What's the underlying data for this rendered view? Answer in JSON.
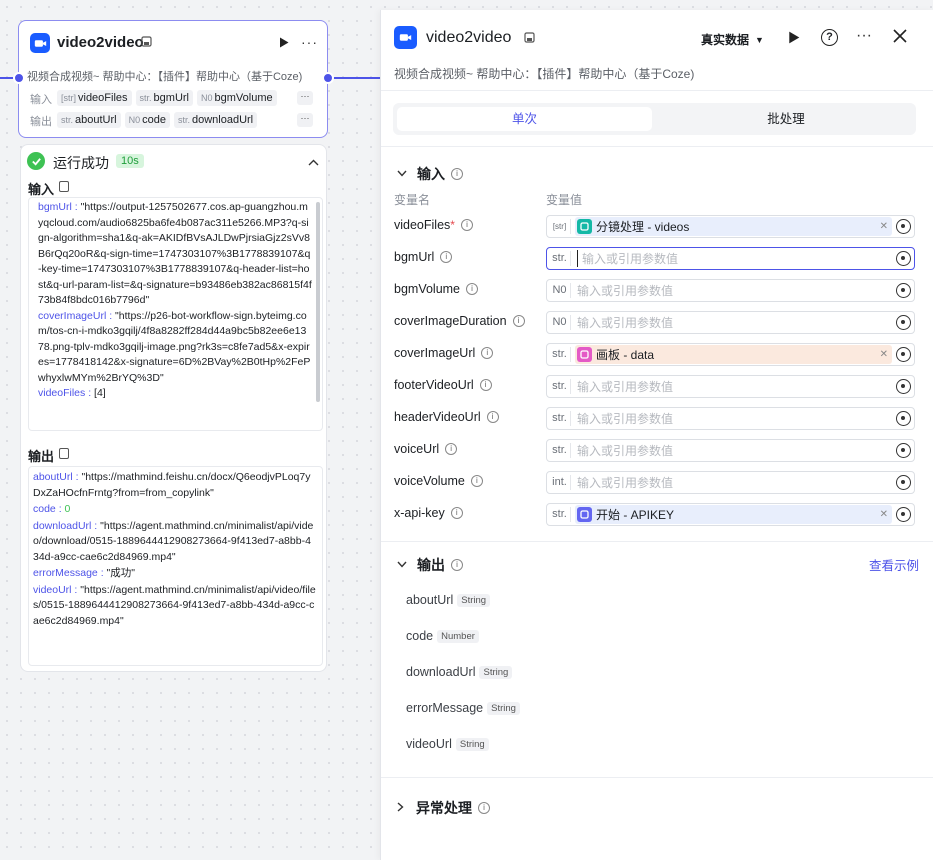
{
  "node": {
    "title": "video2video",
    "description": "视频合成视频~ 帮助中心：【插件】帮助中心（基于Coze)",
    "input_label": "输入",
    "output_label": "输出",
    "inputs": [
      {
        "type": "[str]",
        "name": "videoFiles"
      },
      {
        "type": "str.",
        "name": "bgmUrl"
      },
      {
        "type": "N0",
        "name": "bgmVolume"
      }
    ],
    "outputs": [
      {
        "type": "str.",
        "name": "aboutUrl"
      },
      {
        "type": "N0",
        "name": "code"
      },
      {
        "type": "str.",
        "name": "downloadUrl"
      }
    ],
    "more": "···"
  },
  "result": {
    "status": "运行成功",
    "time": "10s",
    "input_title": "输入",
    "output_title": "输出",
    "input_entries": [
      {
        "key": "bgmUrl",
        "value": "\"https://output-1257502677.cos.ap-guangzhou.myqcloud.com/audio6825ba6fe4b087ac311e5266.MP3?q-sign-algorithm=sha1&q-ak=AKIDfBVsAJLDwPjrsiaGjz2sVv8B6rQq20oR&q-sign-time=1747303107%3B1778839107&q-key-time=1747303107%3B1778839107&q-header-list=host&q-url-param-list=&q-signature=b93486eb382ac86815f4f73b84f8bdc016b7796d\""
      },
      {
        "key": "coverImageUrl",
        "value": "\"https://p26-bot-workflow-sign.byteimg.com/tos-cn-i-mdko3gqilj/4f8a8282ff284d44a9bc5b82ee6e1378.png-tplv-mdko3gqilj-image.png?rk3s=c8fe7ad5&x-expires=1778418142&x-signature=6D%2BVay%2B0tHp%2FePwhyxlwMYm%2BrYQ%3D\""
      },
      {
        "key": "videoFiles",
        "value": "[4]"
      }
    ],
    "output_entries": [
      {
        "key": "aboutUrl",
        "value": "\"https://mathmind.feishu.cn/docx/Q6eodjvPLoq7yDxZaHOcfnFrntg?from=from_copylink\"",
        "num": false
      },
      {
        "key": "code",
        "value": "0",
        "num": true
      },
      {
        "key": "downloadUrl",
        "value": "\"https://agent.mathmind.cn/minimalist/api/video/download/0515-1889644412908273664-9f413ed7-a8bb-434d-a9cc-cae6c2d84969.mp4\"",
        "num": false
      },
      {
        "key": "errorMessage",
        "value": "\"成功\"",
        "num": false
      },
      {
        "key": "videoUrl",
        "value": "\"https://agent.mathmind.cn/minimalist/api/video/files/0515-1889644412908273664-9f413ed7-a8bb-434d-a9cc-cae6c2d84969.mp4\"",
        "num": false
      }
    ]
  },
  "panel": {
    "title": "video2video",
    "description": "视频合成视频~ 帮助中心：【插件】帮助中心（基于Coze)",
    "data_mode": "真实数据",
    "tabs": [
      "单次",
      "批处理"
    ],
    "input_section": "输入",
    "col_name": "变量名",
    "col_value": "变量值",
    "placeholder": "输入或引用参数值",
    "params": [
      {
        "name": "videoFiles",
        "required": true,
        "type": "[str]",
        "ref": "分镜处理 - videos",
        "ref_color": "#e8eefc",
        "ref_icon": "layers-icon",
        "ref_icon_color": "#14b8a6"
      },
      {
        "name": "bgmUrl",
        "required": false,
        "type": "str.",
        "ref": null,
        "focus": true
      },
      {
        "name": "bgmVolume",
        "required": false,
        "type": "N0",
        "ref": null
      },
      {
        "name": "coverImageDuration",
        "required": false,
        "type": "N0",
        "ref": null
      },
      {
        "name": "coverImageUrl",
        "required": false,
        "type": "str.",
        "ref": "画板 - data",
        "ref_color": "#fbe9de",
        "ref_icon": "canvas-icon",
        "ref_icon_color": "#e45ac6"
      },
      {
        "name": "footerVideoUrl",
        "required": false,
        "type": "str.",
        "ref": null
      },
      {
        "name": "headerVideoUrl",
        "required": false,
        "type": "str.",
        "ref": null
      },
      {
        "name": "voiceUrl",
        "required": false,
        "type": "str.",
        "ref": null
      },
      {
        "name": "voiceVolume",
        "required": false,
        "type": "int.",
        "ref": null
      },
      {
        "name": "x-api-key",
        "required": false,
        "type": "str.",
        "ref": "开始 - APIKEY",
        "ref_color": "#e8eefc",
        "ref_icon": "start-icon",
        "ref_icon_color": "#6366f1"
      }
    ],
    "output_section": "输出",
    "view_example": "查看示例",
    "outputs": [
      {
        "name": "aboutUrl",
        "type": "String"
      },
      {
        "name": "code",
        "type": "Number"
      },
      {
        "name": "downloadUrl",
        "type": "String"
      },
      {
        "name": "errorMessage",
        "type": "String"
      },
      {
        "name": "videoUrl",
        "type": "String"
      }
    ],
    "exception_section": "异常处理"
  },
  "colors": {
    "accent": "#4d53e8",
    "app_icon": "#1a5cff",
    "success": "#3ec254"
  }
}
